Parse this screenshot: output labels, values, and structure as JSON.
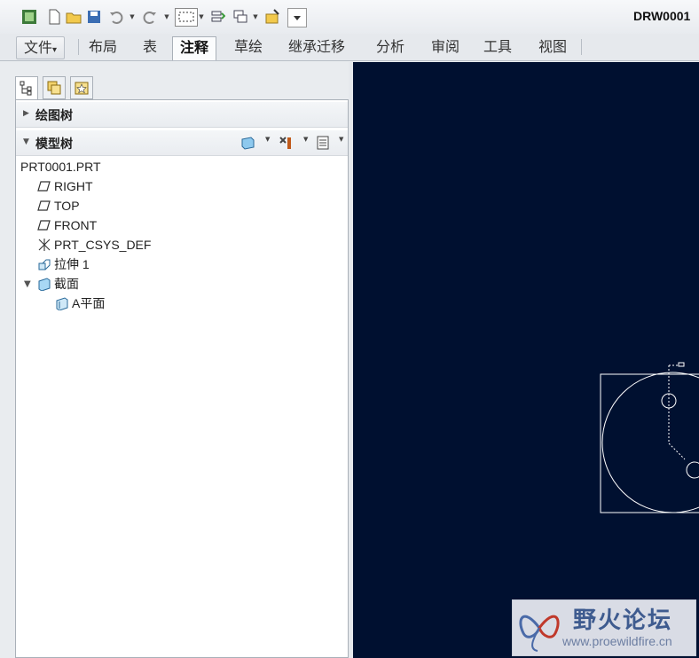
{
  "window": {
    "title": "DRW0001"
  },
  "ribbon": {
    "tabs": [
      {
        "label": "文件",
        "dropdown": "▾"
      },
      {
        "label": "布局"
      },
      {
        "label": "表"
      },
      {
        "label": "注释",
        "active": true
      },
      {
        "label": "草绘"
      },
      {
        "label": "继承迁移"
      },
      {
        "label": "分析"
      },
      {
        "label": "审阅"
      },
      {
        "label": "工具"
      },
      {
        "label": "视图"
      }
    ]
  },
  "navigator": {
    "drawing_tree_label": "绘图树",
    "model_tree_label": "模型树",
    "tree": [
      {
        "label": "PRT0001.PRT",
        "icon": "part-icon"
      },
      {
        "label": "RIGHT",
        "icon": "datum-plane-icon"
      },
      {
        "label": "TOP",
        "icon": "datum-plane-icon"
      },
      {
        "label": "FRONT",
        "icon": "datum-plane-icon"
      },
      {
        "label": "PRT_CSYS_DEF",
        "icon": "csys-icon"
      },
      {
        "label": "拉伸 1",
        "icon": "extrude-icon"
      },
      {
        "label": "截面",
        "icon": "section-icon",
        "expanded": true
      },
      {
        "label": "A平面",
        "icon": "section-plane-icon"
      }
    ]
  },
  "watermark": {
    "name": "野火论坛",
    "url": "www.proewildfire.cn"
  },
  "colors": {
    "graphics_background": "#001030",
    "drawing_lines": "#ffffff"
  }
}
